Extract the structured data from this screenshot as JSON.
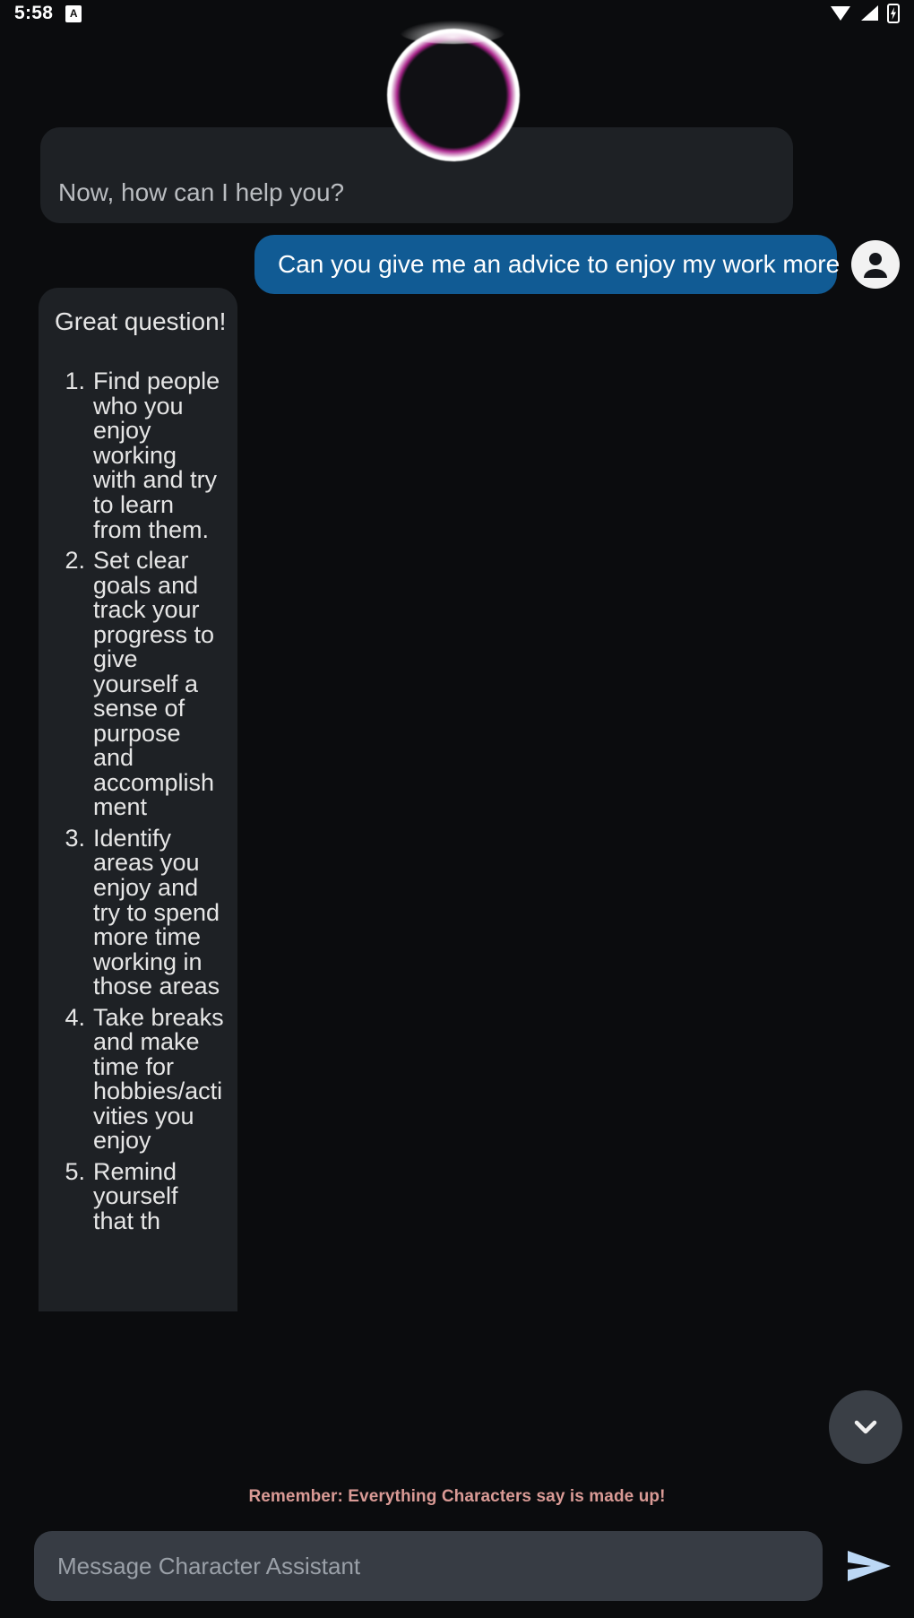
{
  "status_bar": {
    "time": "5:58",
    "notification_badge_label": "A",
    "icons": [
      "wifi-icon",
      "cellular-signal-icon",
      "battery-charging-icon"
    ]
  },
  "header": {
    "bot_avatar": "character-ring-avatar"
  },
  "chat": {
    "greeting": {
      "sender": "bot",
      "text": "Now, how can I help you?"
    },
    "user_message": {
      "sender": "user",
      "text": "Can you give me an advice to enjoy my work more",
      "avatar": "user-account-icon"
    },
    "bot_response": {
      "sender": "bot",
      "intro": "Great question!",
      "list": [
        {
          "number": "1.",
          "text": "Find people who you enjoy working with and try to learn from them."
        },
        {
          "number": "2.",
          "text": "Set clear goals and track your progress to give yourself a sense of purpose and accomplishment"
        },
        {
          "number": "3.",
          "text": "Identify areas you enjoy and try to spend more time working in those areas"
        },
        {
          "number": "4.",
          "text": "Take breaks and make time for hobbies/activities you enjoy"
        },
        {
          "number": "5.",
          "text": "Remind yourself that th"
        }
      ]
    }
  },
  "scroll_down_button": {
    "icon": "chevron-down-icon"
  },
  "disclaimer": {
    "text": "Remember: Everything Characters say is made up!",
    "color": "#d99a95"
  },
  "composer": {
    "placeholder": "Message Character Assistant",
    "value": "",
    "send_icon": "send-arrow-icon",
    "send_color": "#bcd8f5"
  },
  "colors": {
    "background": "#0b0c0e",
    "bot_bubble": "#1e2125",
    "user_bubble": "#115b94",
    "input_field": "#373c44",
    "scroll_button": "#3a3f46"
  }
}
